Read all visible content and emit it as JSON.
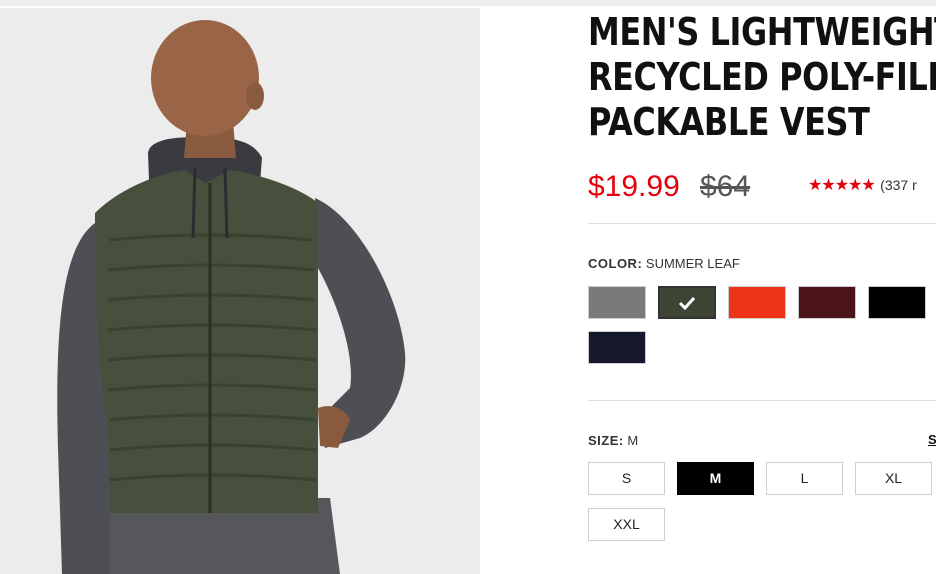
{
  "product": {
    "title_lines": [
      "MEN'S LIGHTWEIGHT",
      "RECYCLED POLY-FILL",
      "PACKABLE VEST"
    ],
    "price": "$19.99",
    "original_price": "$64",
    "rating_stars": "★★★★★",
    "rating_value": 5,
    "reviews_text": "(337 r"
  },
  "color": {
    "label": "COLOR:",
    "selected_name": "SUMMER LEAF",
    "swatches": [
      {
        "name": "gray",
        "hex": "#7a797b",
        "selected": false
      },
      {
        "name": "summer-leaf",
        "hex": "#3f4535",
        "selected": true
      },
      {
        "name": "red-orange",
        "hex": "#ee3319",
        "selected": false
      },
      {
        "name": "burgundy",
        "hex": "#4a1419",
        "selected": false
      },
      {
        "name": "black",
        "hex": "#000000",
        "selected": false
      },
      {
        "name": "navy",
        "hex": "#14182a",
        "selected": false
      }
    ]
  },
  "size": {
    "label": "SIZE:",
    "selected": "M",
    "options": [
      "S",
      "M",
      "L",
      "XL",
      "XXL"
    ],
    "guide_link": "S"
  },
  "colors": {
    "sale_red": "#e3000b",
    "selected_size_bg": "#000000"
  },
  "icons": {
    "selected_swatch": "check-icon",
    "rating": "star-icon"
  }
}
